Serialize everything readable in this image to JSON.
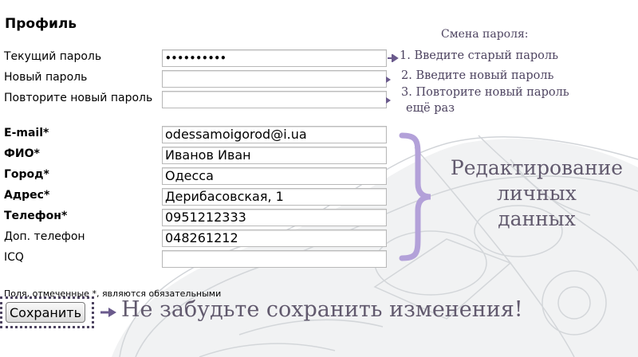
{
  "form": {
    "title": "Профиль",
    "fields": [
      {
        "label": "Текущий пароль",
        "value": "••••••••••",
        "required": false
      },
      {
        "label": "Новый пароль",
        "value": "",
        "required": false
      },
      {
        "label": "Повторите новый пароль",
        "value": "",
        "required": false
      },
      {
        "label": "E-mail*",
        "value": "odessamoigorod@i.ua",
        "required": true
      },
      {
        "label": "ФИО*",
        "value": "Иванов Иван",
        "required": true
      },
      {
        "label": "Город*",
        "value": "Одесса",
        "required": true
      },
      {
        "label": "Адрес*",
        "value": "Дерибасовская, 1",
        "required": true
      },
      {
        "label": "Телефон*",
        "value": "0951212333",
        "required": true
      },
      {
        "label": "Доп. телефон",
        "value": "048261212",
        "required": false
      },
      {
        "label": "ICQ",
        "value": "",
        "required": false
      }
    ],
    "required_hint": "Поля, отмеченные *, являются обязательными",
    "save_label": "Сохранить"
  },
  "annotations": {
    "password_title": "Смена пароля:",
    "step1": "1. Введите старый пароль",
    "step2": "2. Введите новый пароль",
    "step3_line1": "3. Повторите новый пароль",
    "step3_line2": "ещё раз",
    "personal_line1": "Редактирование",
    "personal_line2": "личных",
    "personal_line3": "данных",
    "save_reminder": "Не забудьте сохранить изменения!"
  },
  "colors": {
    "annotation": "#4d4360",
    "brace": "#b3a1d9",
    "arrow": "#6a5a8c"
  },
  "icons": {
    "arrow": "right-arrow-icon",
    "brace": "curly-brace-icon"
  }
}
